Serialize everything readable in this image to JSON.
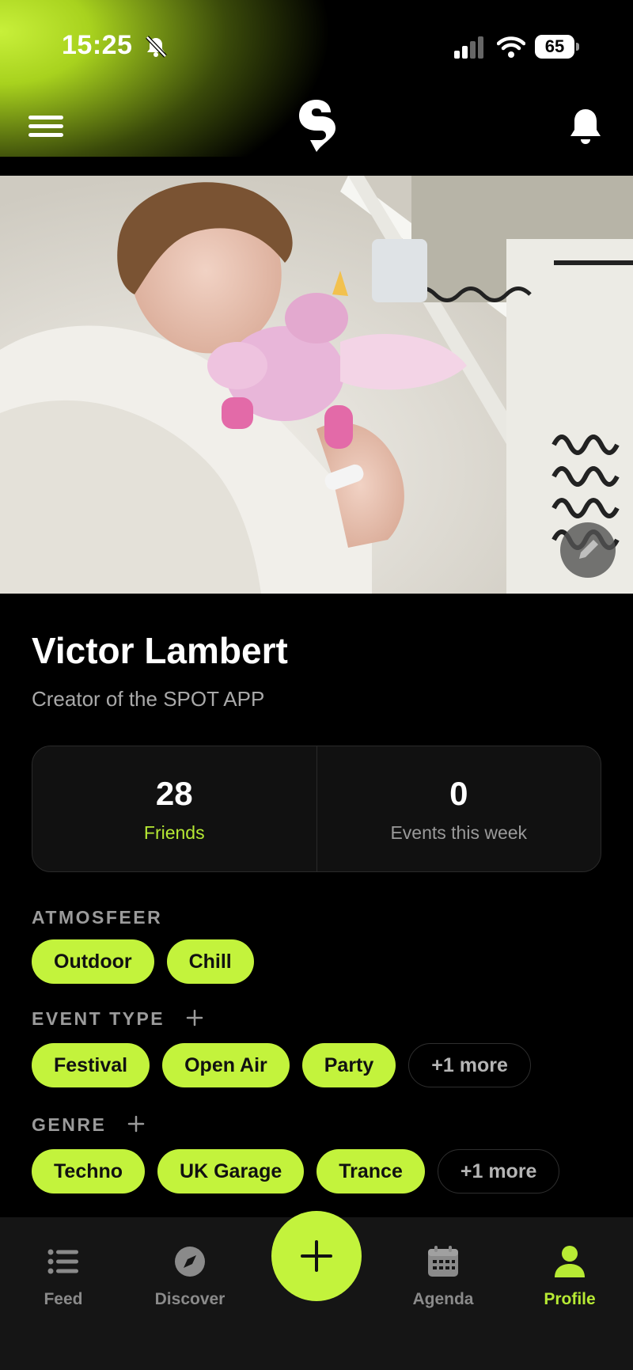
{
  "status_bar": {
    "time": "15:25",
    "battery": "65",
    "icons": [
      "bell-slash-icon",
      "signal-icon",
      "wifi-icon",
      "battery-icon"
    ]
  },
  "header": {
    "menu_icon": "hamburger-menu-icon",
    "logo_icon": "spot-logo-icon",
    "notifications_icon": "bell-icon"
  },
  "cover": {
    "edit_icon": "pencil-icon"
  },
  "profile": {
    "name": "Victor Lambert",
    "bio": "Creator of the SPOT APP"
  },
  "stats": [
    {
      "value": "28",
      "label": "Friends"
    },
    {
      "value": "0",
      "label": "Events this week"
    }
  ],
  "sections": {
    "atmosfeer": {
      "label": "ATMOSFEER",
      "chips": [
        "Outdoor",
        "Chill"
      ]
    },
    "event_type": {
      "label": "EVENT TYPE",
      "chips": [
        "Festival",
        "Open Air",
        "Party"
      ],
      "more": "+1 more"
    },
    "genre": {
      "label": "GENRE",
      "chips": [
        "Techno",
        "UK Garage",
        "Trance"
      ],
      "more": "+1 more"
    }
  },
  "nav": {
    "items": [
      {
        "label": "Feed",
        "icon": "list-icon"
      },
      {
        "label": "Discover",
        "icon": "compass-icon"
      },
      {
        "label": "Agenda",
        "icon": "calendar-icon"
      },
      {
        "label": "Profile",
        "icon": "person-icon"
      }
    ],
    "fab_icon": "plus-icon",
    "active": "Profile"
  },
  "colors": {
    "accent": "#c3f33c",
    "background": "#000000",
    "nav_background": "#151515",
    "muted_text": "#9b9b9b"
  }
}
